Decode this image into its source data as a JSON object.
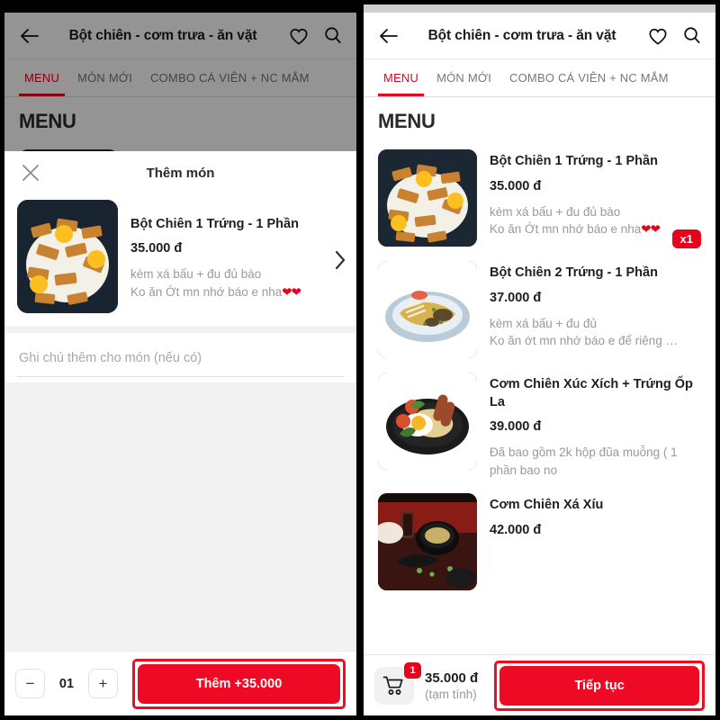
{
  "app": {
    "title": "Bột chiên - cơm trưa - ăn vặt",
    "back_icon": "back-arrow-icon",
    "favorite_icon": "heart-outline-icon",
    "search_icon": "search-icon"
  },
  "tabs": [
    {
      "label": "MENU",
      "active": true
    },
    {
      "label": "MÓN MỚI",
      "active": false
    },
    {
      "label": "COMBO CÁ VIÊN + NC MẮM",
      "active": false
    }
  ],
  "menu": {
    "section_title": "MENU",
    "items": [
      {
        "name": "Bột Chiên 1 Trứng - 1 Phần",
        "price": "35.000 đ",
        "desc_line1": "kèm xá bấu + đu đủ bào",
        "desc_line2": "Ko ăn Ớt  mn nhớ báo e nha",
        "hearts": "❤❤",
        "qty_badge": "x1",
        "image": "bot-chien-trung-photo"
      },
      {
        "name": "Bột Chiên 2 Trứng - 1 Phần",
        "price": "37.000 đ",
        "desc_line1": "kèm xá bấu + đu đủ",
        "desc_line2": "Ko ăn ớt mn nhớ báo e để riêng …",
        "hearts": "",
        "qty_badge": "",
        "image": "bot-chien-2-trung-photo"
      },
      {
        "name": "Cơm Chiên Xúc Xích + Trứng Ốp La",
        "price": "39.000 đ",
        "desc_line1": "Đã bao gồm 2k hộp đũa muỗng ( 1",
        "desc_line2": "phần bao no",
        "hearts": "",
        "qty_badge": "",
        "image": "com-chien-xuc-xich-photo"
      },
      {
        "name": "Cơm Chiên Xá Xíu",
        "price": "42.000 đ",
        "desc_line1": "",
        "desc_line2": "",
        "hearts": "",
        "qty_badge": "",
        "image": "com-chien-xa-xiu-photo"
      }
    ]
  },
  "cartbar": {
    "cart_icon": "shopping-cart-icon",
    "count": "1",
    "total": "35.000 đ",
    "subtitle": "(tạm tính)",
    "continue_label": "Tiếp tục"
  },
  "sheet": {
    "close_icon": "close-x-icon",
    "title": "Thêm món",
    "chevron_icon": "chevron-right-icon",
    "item": {
      "name": "Bột Chiên 1 Trứng - 1 Phần",
      "price": "35.000 đ",
      "desc_line1": "kèm xá bấu + đu đủ bào",
      "desc_line2": "Ko ăn Ớt  mn nhớ báo e nha",
      "hearts": "❤❤",
      "image": "bot-chien-trung-photo"
    },
    "note_placeholder": "Ghi chú thêm cho món (nếu có)",
    "note_value": "",
    "stepper": {
      "minus_label": "−",
      "value": "01",
      "plus_label": "+"
    },
    "add_label": "Thêm +35.000"
  },
  "colors": {
    "accent_red": "#e8001d",
    "button_red": "#ee0a24",
    "highlight_red": "#f00c1e"
  }
}
